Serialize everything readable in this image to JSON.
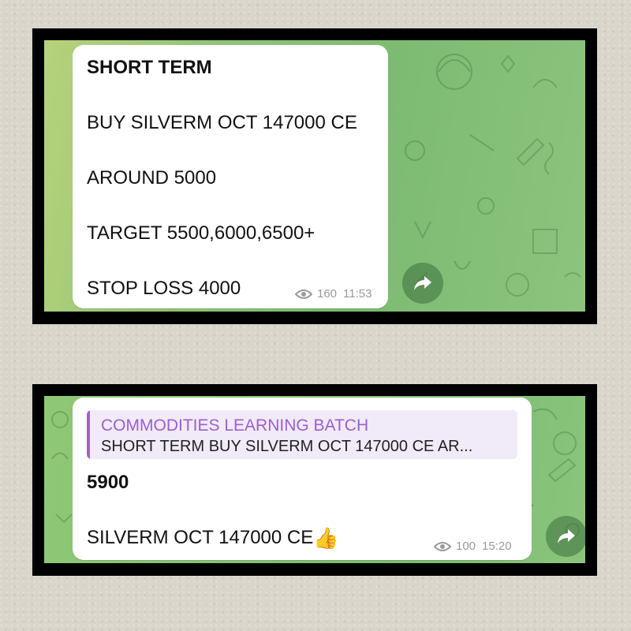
{
  "post1": {
    "lines": [
      "SHORT TERM",
      "BUY SILVERM OCT 147000 CE",
      "AROUND 5000",
      "TARGET 5500,6000,6500+",
      "STOP LOSS 4000"
    ],
    "views": "160",
    "time": "11:53"
  },
  "post2": {
    "reply": {
      "channel": "COMMODITIES LEARNING BATCH",
      "snippet": "SHORT TERM BUY SILVERM OCT 147000 CE AR..."
    },
    "lines": [
      "5900",
      "SILVERM OCT 147000 CE"
    ],
    "emoji": "👍",
    "views": "100",
    "time": "15:20"
  },
  "icons": [
    "eye-icon",
    "forward-icon",
    "thumbs-up-icon"
  ],
  "colors": {
    "chat_green": "#7dbb72",
    "reply_accent": "#9c63cf",
    "meta_gray": "#9a9a9a"
  }
}
